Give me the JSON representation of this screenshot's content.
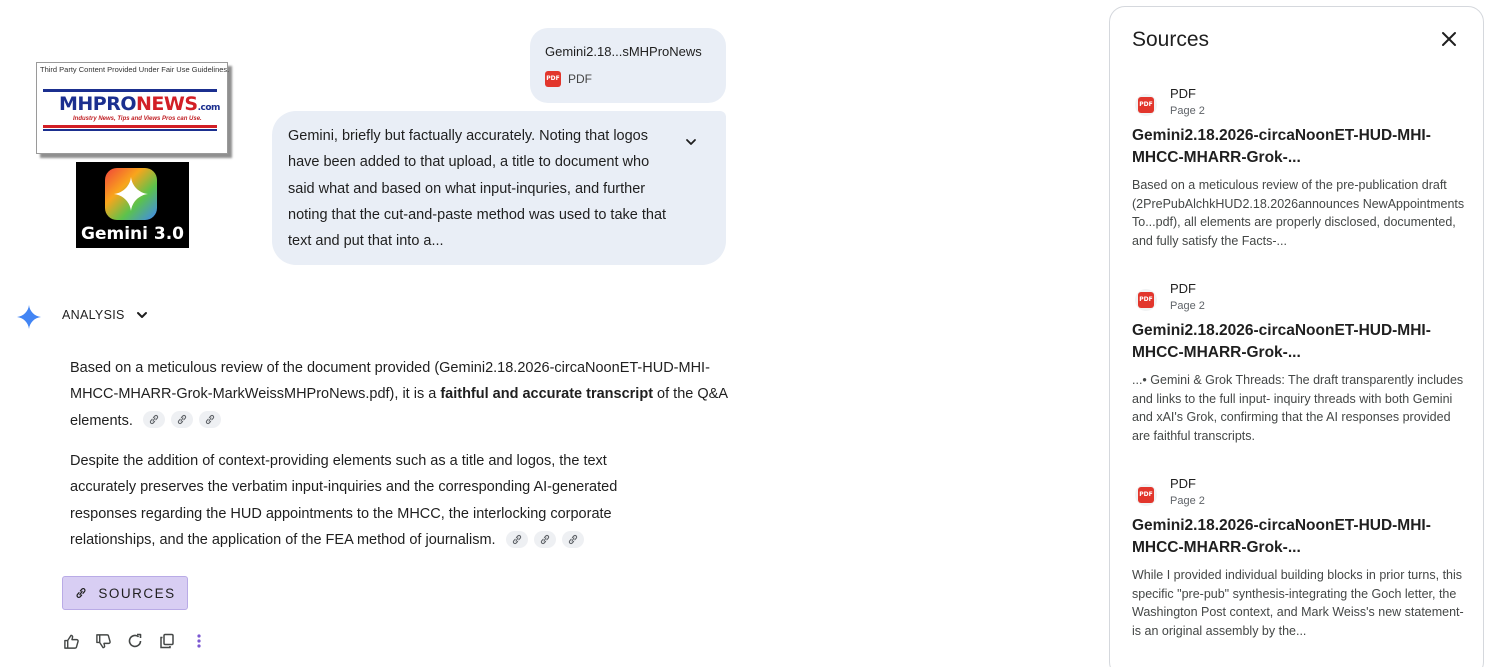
{
  "logos": {
    "mhpronews": {
      "notice": "Third Party Content Provided Under Fair Use Guidelines.",
      "brand_a": "MHPRO",
      "brand_b": "NEWS",
      "brand_c": ".com",
      "tagline": "Industry News, Tips and Views Pros can Use."
    },
    "gemini": {
      "caption": "Gemini 3.0"
    }
  },
  "upload": {
    "filename": "Gemini2.18...sMHProNews",
    "type": "PDF"
  },
  "prompt": {
    "text": "Gemini, briefly but factually accurately. Noting that logos have been added to that upload, a title to document who said what and based on what input-inquries, and further noting that the cut-and-paste method was used to take that text and put that into a..."
  },
  "response": {
    "header": "ANALYSIS",
    "p1_a": "Based on a meticulous review of the document provided (Gemini2.18.2026-circaNoonET-HUD-MHI-MHCC-MHARR-Grok-MarkWeissMHProNews.pdf), it is a ",
    "p1_bold": "faithful and accurate transcript",
    "p1_b": " of the Q&A elements.",
    "p2": "Despite the addition of context-providing elements such as a title and logos, the text accurately preserves the verbatim input-inquiries and the corresponding AI-generated responses regarding the HUD appointments to the MHCC, the interlocking corporate relationships, and the application of the FEA method of journalism.",
    "sources_button": "SOURCES"
  },
  "sources_panel": {
    "title": "Sources",
    "items": [
      {
        "type": "PDF",
        "page": "Page 2",
        "title": "Gemini2.18.2026-circaNoonET-HUD-MHI-MHCC-MHARR-Grok-...",
        "snippet": "Based on a meticulous review of the pre-publication draft (2PrePubAlchkHUD2.18.2026announces NewAppointments To...pdf), all elements are properly disclosed, documented, and fully satisfy the Facts-..."
      },
      {
        "type": "PDF",
        "page": "Page 2",
        "title": "Gemini2.18.2026-circaNoonET-HUD-MHI-MHCC-MHARR-Grok-...",
        "snippet": "...• Gemini & Grok Threads: The draft transparently includes and links to the full input- inquiry threads with both Gemini and xAI's Grok, confirming that the AI responses provided are faithful transcripts."
      },
      {
        "type": "PDF",
        "page": "Page 2",
        "title": "Gemini2.18.2026-circaNoonET-HUD-MHI-MHCC-MHARR-Grok-...",
        "snippet": "While I provided individual building blocks in prior turns, this specific \"pre-pub\" synthesis-integrating the Goch letter, the Washington Post context, and Mark Weiss's new statement-is an original assembly by the..."
      }
    ]
  },
  "icons": {
    "thumb_up": "thumb-up-icon",
    "thumb_down": "thumb-down-icon",
    "refresh": "refresh-icon",
    "copy": "copy-icon",
    "more": "more-vert-icon",
    "accent": "#4285f4"
  }
}
